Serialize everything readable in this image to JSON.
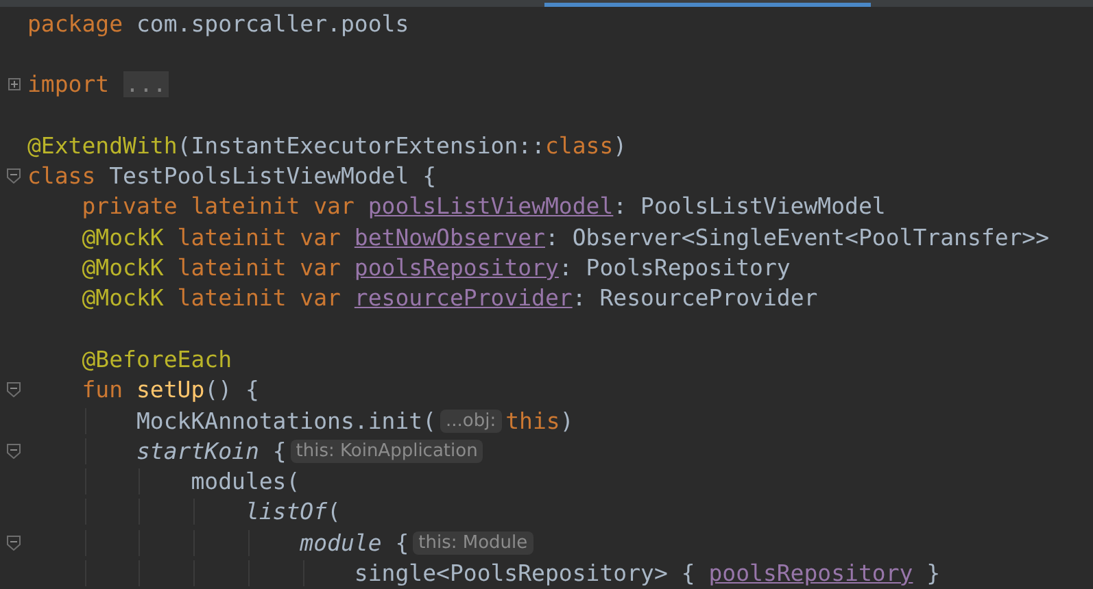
{
  "editor_tab": {
    "selected": true
  },
  "blocks": [
    [
      {
        "tokens": [
          {
            "kind": "keyword",
            "text": "package"
          },
          {
            "kind": "plain",
            "text": " com.sporcaller.pools"
          }
        ]
      }
    ],
    [
      {
        "expanded": false,
        "tokens": [
          {
            "kind": "keyword",
            "text": "import "
          },
          {
            "kind": "folded",
            "text": "..."
          }
        ]
      }
    ],
    [
      {
        "tokens": [
          {
            "kind": "annotation",
            "text": "@ExtendWith"
          },
          {
            "kind": "plain",
            "text": "(InstantExecutorExtension::"
          },
          {
            "kind": "keyword",
            "text": "class"
          },
          {
            "kind": "plain",
            "text": ")"
          }
        ]
      },
      {
        "expanded": true,
        "tokens": [
          {
            "kind": "keyword",
            "text": "class"
          },
          {
            "kind": "plain",
            "text": " TestPoolsListViewModel {"
          }
        ]
      },
      {
        "tokens": [
          {
            "kind": "keyword",
            "text": "    private lateinit var "
          },
          {
            "kind": "field",
            "text": "poolsListViewModel"
          },
          {
            "kind": "plain",
            "text": ": PoolsListViewModel"
          }
        ]
      },
      {
        "tokens": [
          {
            "kind": "annotation",
            "text": "    @MockK"
          },
          {
            "kind": "keyword",
            "text": " lateinit var "
          },
          {
            "kind": "field",
            "text": "betNowObserver"
          },
          {
            "kind": "plain",
            "text": ": Observer<SingleEvent<PoolTransfer>>"
          }
        ]
      },
      {
        "tokens": [
          {
            "kind": "annotation",
            "text": "    @MockK"
          },
          {
            "kind": "keyword",
            "text": " lateinit var "
          },
          {
            "kind": "field",
            "text": "poolsRepository"
          },
          {
            "kind": "plain",
            "text": ": PoolsRepository"
          }
        ]
      },
      {
        "tokens": [
          {
            "kind": "annotation",
            "text": "    @MockK"
          },
          {
            "kind": "keyword",
            "text": " lateinit var "
          },
          {
            "kind": "field",
            "text": "resourceProvider"
          },
          {
            "kind": "plain",
            "text": ": ResourceProvider"
          }
        ]
      }
    ],
    [
      {
        "tokens": [
          {
            "kind": "annotation",
            "text": "    @BeforeEach"
          }
        ]
      },
      {
        "expanded": true,
        "tokens": [
          {
            "kind": "keyword",
            "text": "    fun "
          },
          {
            "kind": "function",
            "text": "setUp"
          },
          {
            "kind": "plain",
            "text": "() {"
          }
        ]
      },
      {
        "tokens": [
          {
            "kind": "plain",
            "text": "        MockKAnnotations.init("
          },
          {
            "kind": "hint",
            "text": "...obj:"
          },
          {
            "kind": "keyword",
            "text": "this"
          },
          {
            "kind": "plain",
            "text": ")"
          }
        ]
      },
      {
        "expanded": true,
        "tokens": [
          {
            "kind": "call",
            "text": "        startKoin"
          },
          {
            "kind": "plain",
            "text": " {"
          },
          {
            "kind": "hint",
            "text": "this: KoinApplication"
          }
        ]
      },
      {
        "tokens": [
          {
            "kind": "plain",
            "text": "            modules("
          }
        ]
      },
      {
        "tokens": [
          {
            "kind": "call",
            "text": "                listOf"
          },
          {
            "kind": "plain",
            "text": "("
          }
        ]
      },
      {
        "expanded": true,
        "tokens": [
          {
            "kind": "call",
            "text": "                    module"
          },
          {
            "kind": "plain",
            "text": " {"
          },
          {
            "kind": "hint",
            "text": "this: Module"
          }
        ]
      },
      {
        "tokens": [
          {
            "kind": "plain",
            "text": "                        single<PoolsRepository> { "
          },
          {
            "kind": "field",
            "text": "poolsRepository"
          },
          {
            "kind": "plain",
            "text": " }"
          }
        ]
      }
    ]
  ]
}
